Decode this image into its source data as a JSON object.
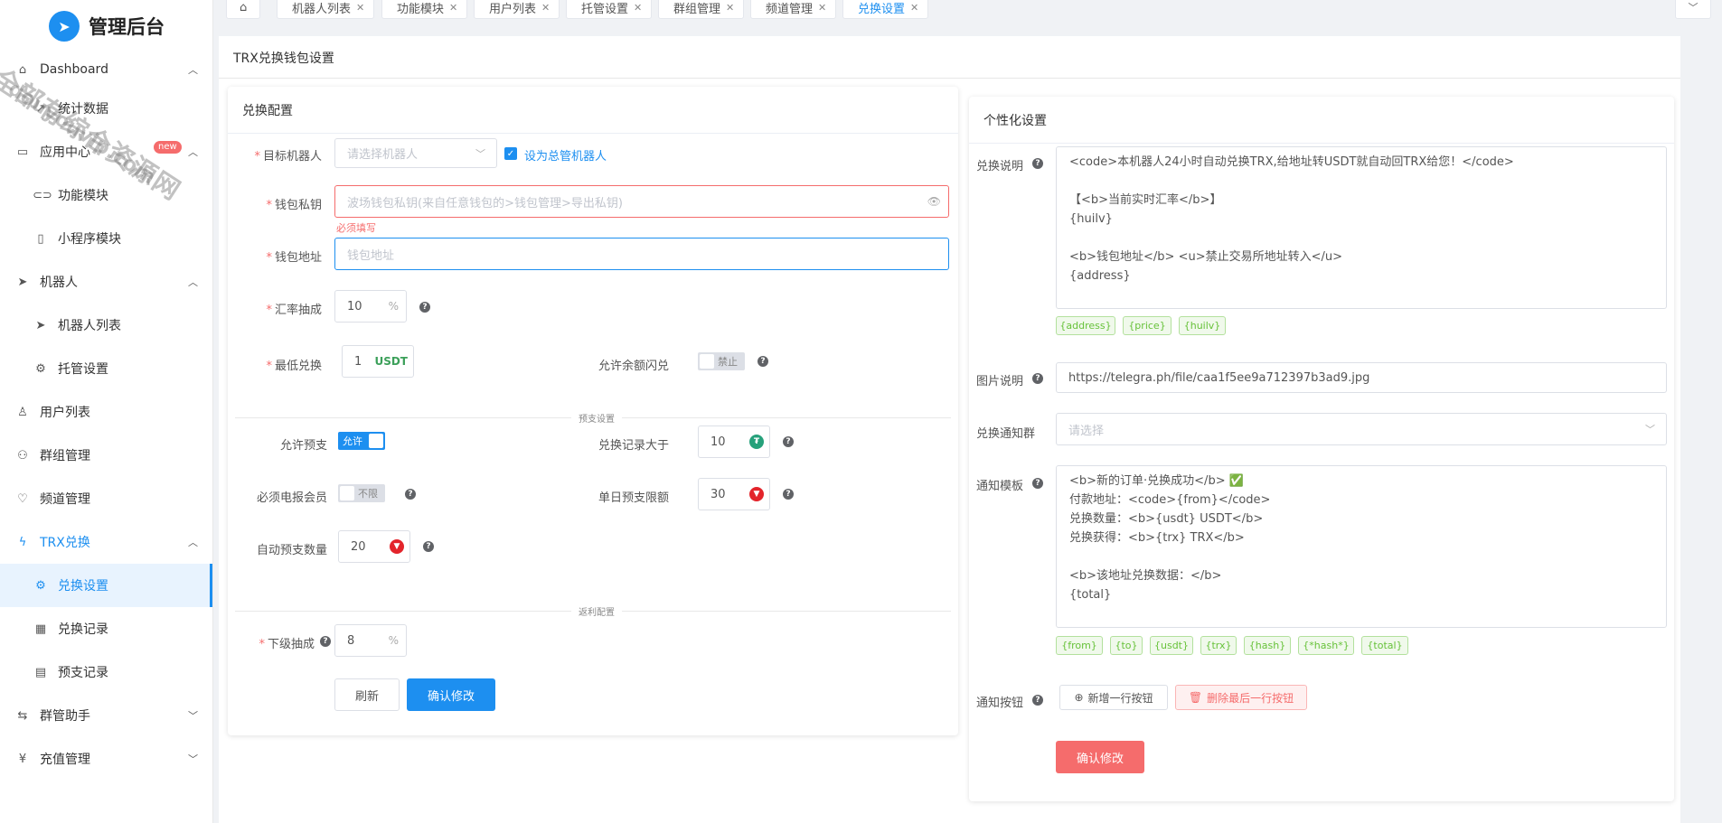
{
  "app": {
    "title": "管理后台"
  },
  "watermark": {
    "line1": "全部有综合资源网",
    "line2": "douyouvip.com"
  },
  "sidebar": {
    "items": [
      {
        "label": "Dashboard",
        "icon": "home-icon"
      },
      {
        "label": "统计数据",
        "icon": "trend-icon"
      },
      {
        "label": "应用中心",
        "icon": "app-icon",
        "badge": "new"
      },
      {
        "label": "功能模块",
        "icon": "toggle-icon"
      },
      {
        "label": "小程序模块",
        "icon": "mobile-icon"
      },
      {
        "label": "机器人",
        "icon": "send-icon"
      },
      {
        "label": "机器人列表",
        "icon": "send-icon"
      },
      {
        "label": "托管设置",
        "icon": "gears-icon"
      },
      {
        "label": "用户列表",
        "icon": "user-icon"
      },
      {
        "label": "群组管理",
        "icon": "users-icon"
      },
      {
        "label": "频道管理",
        "icon": "heart-icon"
      },
      {
        "label": "TRX兑换",
        "icon": "bolt-icon"
      },
      {
        "label": "兑换设置",
        "icon": "settings-icon"
      },
      {
        "label": "兑换记录",
        "icon": "table-icon"
      },
      {
        "label": "预支记录",
        "icon": "doc-icon"
      },
      {
        "label": "群管助手",
        "icon": "flow-icon"
      },
      {
        "label": "充值管理",
        "icon": "yen-icon"
      }
    ]
  },
  "tabs": [
    {
      "label": "机器人列表"
    },
    {
      "label": "功能模块"
    },
    {
      "label": "用户列表"
    },
    {
      "label": "托管设置"
    },
    {
      "label": "群组管理"
    },
    {
      "label": "频道管理"
    },
    {
      "label": "兑换设置"
    }
  ],
  "page": {
    "title": "TRX兑换钱包设置"
  },
  "exchange": {
    "title": "兑换配置",
    "target_bot_label": "目标机器人",
    "target_bot_placeholder": "请选择机器人",
    "set_master_label": "设为总管机器人",
    "private_key_label": "钱包私钥",
    "private_key_placeholder": "波场钱包私钥(来自任意钱包的>钱包管理>导出私钥)",
    "required_text": "必须填写",
    "address_label": "钱包地址",
    "address_placeholder": "钱包地址",
    "rate_label": "汇率抽成",
    "rate_value": "10",
    "percent": "%",
    "min_label": "最低兑换",
    "min_value": "1",
    "min_unit": "USDT",
    "flash_label": "允许余额闪兑",
    "flash_switch": "禁止",
    "advance_divider": "预支设置",
    "allow_advance_label": "允许预支",
    "allow_advance_switch": "允许",
    "record_gt_label": "兑换记录大于",
    "record_gt_value": "10",
    "tg_member_label": "必须电报会员",
    "tg_member_switch": "不限",
    "daily_limit_label": "单日预支限额",
    "daily_limit_value": "30",
    "auto_amount_label": "自动预支数量",
    "auto_amount_value": "20",
    "rebate_divider": "返利配置",
    "sub_rate_label": "下级抽成",
    "sub_rate_value": "8",
    "refresh_btn": "刷新",
    "confirm_btn": "确认修改"
  },
  "personal": {
    "title": "个性化设置",
    "desc_label": "兑换说明",
    "desc_text": "<code>本机器人24小时自动兑换TRX,给地址转USDT就自动回TRX给您！</code>\n\n【<b>当前实时汇率</b>】\n{huilv}\n\n<b>钱包地址</b> <u>禁止交易所地址转入</u>\n{address}",
    "desc_tags": [
      "{address}",
      "{price}",
      "{huilv}"
    ],
    "image_label": "图片说明",
    "image_value": "https://telegra.ph/file/caa1f5ee9a712397b3ad9.jpg",
    "group_label": "兑换通知群",
    "group_placeholder": "请选择",
    "template_label": "通知模板",
    "template_text": "<b>新的订单·兑换成功</b> ✅\n付款地址：<code>{from}</code>\n兑换数量：<b>{usdt} USDT</b>\n兑换获得：<b>{trx} TRX</b>\n\n<b>该地址兑换数据：</b>\n{total}",
    "template_tags": [
      "{from}",
      "{to}",
      "{usdt}",
      "{trx}",
      "{hash}",
      "{*hash*}",
      "{total}"
    ],
    "buttons_label": "通知按钮",
    "add_row_btn": "新增一行按钮",
    "del_row_btn": "删除最后一行按钮",
    "confirm_btn": "确认修改"
  },
  "colors": {
    "primary": "#1d8ff0",
    "danger": "#f56c6c",
    "success": "#67c23a"
  }
}
